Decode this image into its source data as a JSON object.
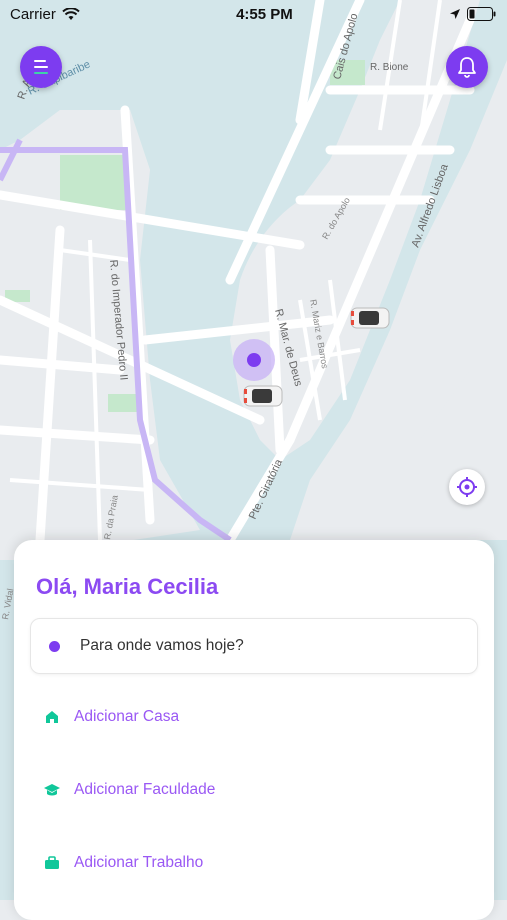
{
  "status_bar": {
    "carrier": "Carrier",
    "time": "4:55 PM"
  },
  "map": {
    "street_labels": [
      "R. Aurora",
      "R. Capibaribe",
      "Cais do Apolo",
      "R. Bione",
      "Av. Alfredo Lisboa",
      "R. do Apolo",
      "R. do Imperador Pedro II",
      "R. Mar. de Deus",
      "R. Mariz e Barros",
      "Pte. Giratória",
      "R. da Praia",
      "R. Vidal"
    ]
  },
  "icons": {
    "menu": "menu-icon",
    "notifications": "bell-icon",
    "locate": "crosshair-icon",
    "home": "home-icon",
    "school": "graduation-cap-icon",
    "work": "briefcase-icon"
  },
  "colors": {
    "accent": "#7d3cf0",
    "accent_text": "#8c4af2",
    "shortcut_icon": "#10c79a",
    "water": "#d3e6ea",
    "land": "#e9ecef",
    "park": "#c5e8cc",
    "route": "#c8b6f5"
  },
  "sheet": {
    "greeting": "Olá, Maria Cecilia",
    "search_placeholder": "Para onde vamos hoje?",
    "shortcuts": [
      {
        "label": "Adicionar Casa"
      },
      {
        "label": "Adicionar Faculdade"
      },
      {
        "label": "Adicionar Trabalho"
      }
    ]
  }
}
